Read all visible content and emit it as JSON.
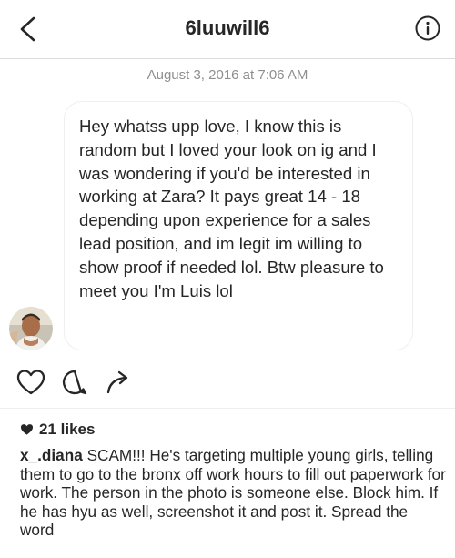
{
  "header": {
    "username": "6luuwill6",
    "back_icon": "chevron-left-icon",
    "info_icon": "info-icon"
  },
  "thread": {
    "timestamp": "August 3, 2016 at 7:06 AM",
    "message": "Hey whatss upp love, I know this is random but I loved your look on ig and I was wondering if you'd be interested in working at Zara? It pays great 14 - 18 depending upon experience for a sales lead position, and im legit im willing to show proof if needed lol. Btw pleasure to meet you I'm Luis lol",
    "avatar": "avatar"
  },
  "post": {
    "actions": [
      "heart-icon",
      "comment-icon",
      "share-icon"
    ],
    "likes": "21 likes",
    "caption_user": "x_.diana",
    "caption_text": " SCAM!!! He's targeting multiple young girls, telling them to go to the bronx off work hours to fill out paperwork for work. The person in the photo is someone else. Block him. If he has hyu as well, screenshot it and post it. Spread the word"
  }
}
